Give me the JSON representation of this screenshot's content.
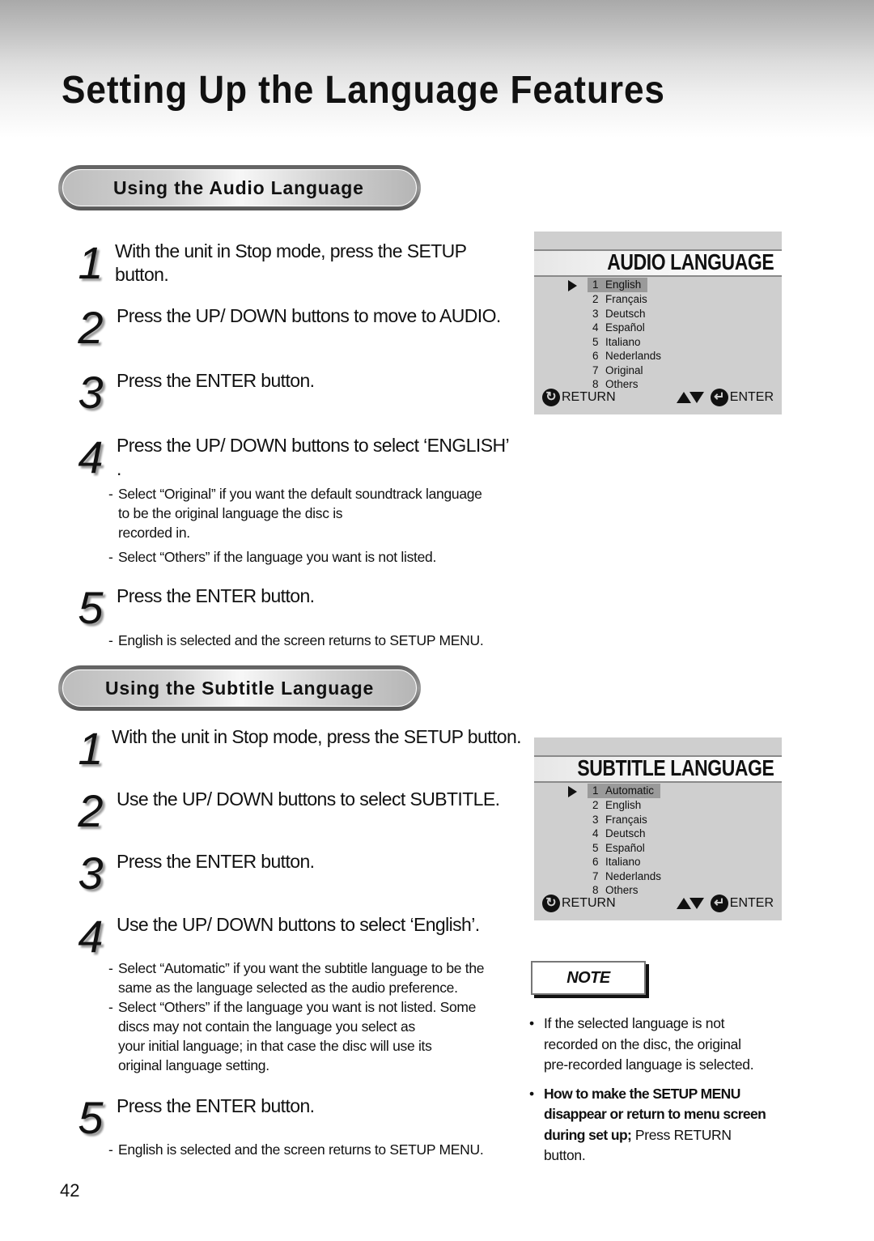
{
  "page": {
    "title": "Setting Up the Language Features",
    "page_number": "42"
  },
  "audio_section": {
    "heading": "Using the Audio Language",
    "steps": [
      {
        "num": "1",
        "lines": [
          "With the unit in Stop mode, press the SETUP",
          "button."
        ]
      },
      {
        "num": "2",
        "lines": [
          "Press the UP/ DOWN buttons to move to AUDIO."
        ]
      },
      {
        "num": "3",
        "lines": [
          "Press the ENTER button."
        ]
      },
      {
        "num": "4",
        "lines": [
          "Press the UP/ DOWN buttons to select ‘ENGLISH’",
          "."
        ]
      },
      {
        "num": "5",
        "lines": [
          "Press the ENTER button."
        ]
      }
    ],
    "step4_notes": [
      {
        "dash": "-",
        "lines": [
          "Select “Original” if you want the default soundtrack language",
          "to be the original language the disc is",
          "recorded in."
        ]
      },
      {
        "dash": "-",
        "lines": [
          "Select “Others” if the language you want is not listed."
        ]
      }
    ],
    "step5_notes": [
      {
        "dash": "-",
        "lines": [
          "English is selected and the screen returns to SETUP MENU."
        ]
      }
    ]
  },
  "audio_osd": {
    "title": "AUDIO LANGUAGE",
    "selected_index": 0,
    "items": [
      {
        "num": "1",
        "label": "English"
      },
      {
        "num": "2",
        "label": "Français"
      },
      {
        "num": "3",
        "label": "Deutsch"
      },
      {
        "num": "4",
        "label": "Español"
      },
      {
        "num": "5",
        "label": "Italiano"
      },
      {
        "num": "6",
        "label": "Nederlands"
      },
      {
        "num": "7",
        "label": "Original"
      },
      {
        "num": "8",
        "label": "Others"
      }
    ],
    "return_label": "RETURN",
    "enter_label": "ENTER"
  },
  "subtitle_section": {
    "heading": "Using the Subtitle Language",
    "steps": [
      {
        "num": "1",
        "lines": [
          "With the unit in Stop mode, press the SETUP button."
        ]
      },
      {
        "num": "2",
        "lines": [
          "Use the UP/ DOWN buttons to select SUBTITLE."
        ]
      },
      {
        "num": "3",
        "lines": [
          "Press the ENTER button."
        ]
      },
      {
        "num": "4",
        "lines": [
          "Use the UP/ DOWN buttons to select ‘English’."
        ]
      },
      {
        "num": "5",
        "lines": [
          "Press the ENTER button."
        ]
      }
    ],
    "step4_notes": [
      {
        "dash": "-",
        "lines": [
          "Select “Automatic” if you want the subtitle language to be the",
          "same as the language selected as the audio preference."
        ]
      },
      {
        "dash": "-",
        "lines": [
          "Select “Others” if the language you want is not listed. Some",
          "discs may not contain the language you  select as",
          "your initial language; in that case the disc will use its",
          "original language setting."
        ]
      }
    ],
    "step5_notes": [
      {
        "dash": "-",
        "lines": [
          "English is selected and the screen returns to SETUP MENU."
        ]
      }
    ]
  },
  "subtitle_osd": {
    "title": "SUBTITLE LANGUAGE",
    "selected_index": 0,
    "items": [
      {
        "num": "1",
        "label": "Automatic"
      },
      {
        "num": "2",
        "label": "English"
      },
      {
        "num": "3",
        "label": "Français"
      },
      {
        "num": "4",
        "label": "Deutsch"
      },
      {
        "num": "5",
        "label": "Español"
      },
      {
        "num": "6",
        "label": "Italiano"
      },
      {
        "num": "7",
        "label": "Nederlands"
      },
      {
        "num": "8",
        "label": "Others"
      }
    ],
    "return_label": "RETURN",
    "enter_label": "ENTER"
  },
  "note": {
    "label": "NOTE",
    "bullets": [
      {
        "bullet": "•",
        "lines": [
          "If the selected language is not",
          "recorded on the disc, the original",
          "pre-recorded language is selected."
        ]
      },
      {
        "bullet": "•",
        "strong_lines": [
          "How to make the SETUP MENU",
          "disappear or return to menu screen",
          "during set up;"
        ],
        "trailing": " Press RETURN button."
      }
    ]
  },
  "icons": {
    "return_icon": "↻",
    "enter_icon": "↵"
  }
}
